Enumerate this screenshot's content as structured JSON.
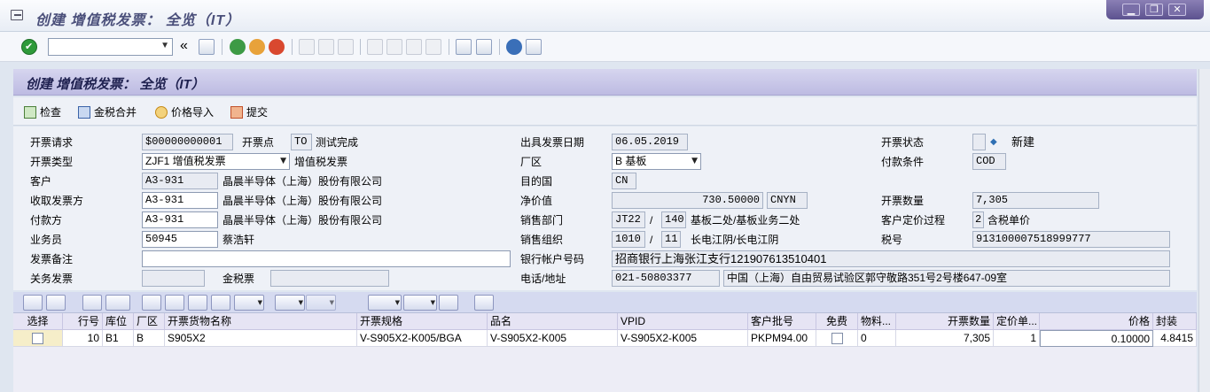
{
  "window": {
    "title": "创建 增值税发票： 全览（IT）",
    "min": "▁",
    "restore": "❐",
    "close": "✕"
  },
  "toolbar": {
    "command_value": "",
    "back_chevron": "«"
  },
  "screen": {
    "title": "创建 增值税发票： 全览（IT）"
  },
  "app_toolbar": {
    "check": "检查",
    "merge_tax": "金税合并",
    "price_import": "价格导入",
    "submit": "提交"
  },
  "form": {
    "invoice_request": {
      "label": "开票请求",
      "value": "$00000000001"
    },
    "invoice_point": {
      "label": "开票点",
      "value": "TO",
      "desc": "测试完成"
    },
    "invoice_type": {
      "label": "开票类型",
      "value": "ZJF1 增值税发票",
      "desc": "增值税发票"
    },
    "customer": {
      "label": "客户",
      "value": "A3-931",
      "desc": "晶晨半导体（上海）股份有限公司"
    },
    "bill_to": {
      "label": "收取发票方",
      "value": "A3-931",
      "desc": "晶晨半导体（上海）股份有限公司"
    },
    "payer": {
      "label": "付款方",
      "value": "A3-931",
      "desc": "晶晨半导体（上海）股份有限公司"
    },
    "salesperson": {
      "label": "业务员",
      "value": "50945",
      "desc": "蔡浩轩"
    },
    "remark": {
      "label": "发票备注",
      "value": ""
    },
    "customs_invoice": {
      "label": "关务发票",
      "value": ""
    },
    "gold_tax_invoice": {
      "label": "金税票",
      "value": ""
    },
    "issue_date": {
      "label": "出具发票日期",
      "value": "06.05.2019"
    },
    "plant": {
      "label": "厂区",
      "value": "B 基板"
    },
    "destination": {
      "label": "目的国",
      "value": "CN"
    },
    "net_value": {
      "label": "净价值",
      "value": "730.50000",
      "currency": "CNYN"
    },
    "sales_office": {
      "label": "销售部门",
      "value": "JT22",
      "sep": "/",
      "value2": "140",
      "desc": "基板二处/基板业务二处"
    },
    "sales_org": {
      "label": "销售组织",
      "value": "1010",
      "sep": "/",
      "value2": "11",
      "desc": "长电江阴/长电江阴"
    },
    "bank": {
      "label": "银行帐户号码",
      "value": "招商银行上海张江支行121907613510401"
    },
    "phone_addr": {
      "label": "电话/地址",
      "phone": "021-50803377",
      "address": "中国（上海）自由贸易试验区郭守敬路351号2号楼647-09室"
    },
    "status": {
      "label": "开票状态",
      "desc": "新建"
    },
    "payment_terms": {
      "label": "付款条件",
      "value": "COD"
    },
    "invoice_qty": {
      "label": "开票数量",
      "value": "7,305"
    },
    "pricing_proc": {
      "label": "客户定价过程",
      "value": "2",
      "desc": "含税单价"
    },
    "tax_no": {
      "label": "税号",
      "value": "913100007518999777"
    }
  },
  "grid": {
    "headers": [
      "选择",
      "行号",
      "库位",
      "厂区",
      "开票货物名称",
      "开票规格",
      "品名",
      "VPID",
      "客户批号",
      "免费",
      "物料...",
      "开票数量",
      "定价单...",
      "价格",
      "封装"
    ],
    "rows": [
      {
        "line": "10",
        "sloc": "B1",
        "plant": "B",
        "goods_name": "S905X2",
        "spec": "V-S905X2-K005/BGA",
        "product": "V-S905X2-K005",
        "vpid": "V-S905X2-K005",
        "lot": "PKPM94.00",
        "material": "0",
        "qty": "7,305",
        "price_unit": "1",
        "price": "0.10000",
        "package": "4.8415"
      }
    ]
  }
}
